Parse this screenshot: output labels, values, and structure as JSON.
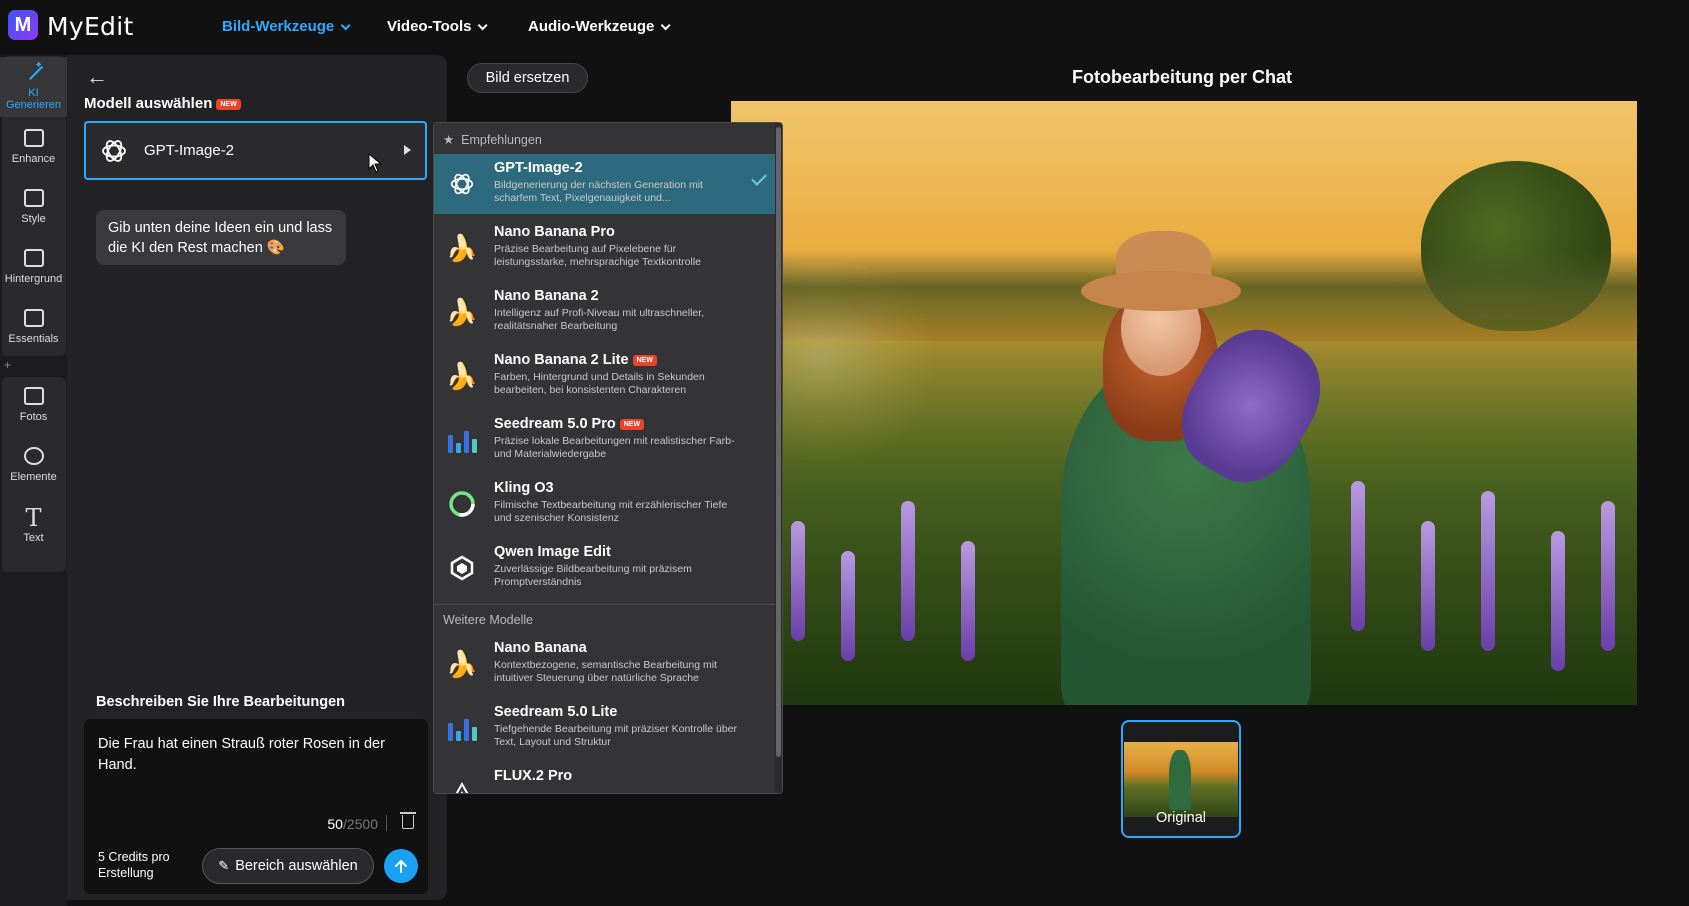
{
  "header": {
    "brand": "MyEdit",
    "logo_letter": "M",
    "nav": [
      {
        "label": "Bild-Werkzeuge",
        "active": true
      },
      {
        "label": "Video-Tools",
        "active": false
      },
      {
        "label": "Audio-Werkzeuge",
        "active": false
      }
    ]
  },
  "rail": {
    "items": [
      {
        "label": "KI Generieren",
        "icon": "magic-wand-icon",
        "active": true
      },
      {
        "label": "Enhance",
        "icon": "enhance-icon"
      },
      {
        "label": "Style",
        "icon": "style-icon"
      },
      {
        "label": "Hintergrund",
        "icon": "background-icon"
      },
      {
        "label": "Essentials",
        "icon": "essentials-icon"
      },
      {
        "label": "Fotos",
        "icon": "photos-icon"
      },
      {
        "label": "Elemente",
        "icon": "elements-icon"
      },
      {
        "label": "Text",
        "icon": "text-icon"
      }
    ],
    "add_symbol": "+"
  },
  "panel": {
    "model_label": "Modell auswählen",
    "new_badge": "NEW",
    "selected_model": "GPT-Image-2",
    "bubble_text": "Gib unten deine Ideen ein und lass die KI den Rest machen 🎨",
    "describe_label": "Beschreiben Sie Ihre Bearbeitungen",
    "prompt_value": "Die Frau hat einen Strauß roter Rosen in der Hand.",
    "char_count": "50",
    "char_max": "/2500",
    "credits": "5 Credits pro Erstellung",
    "area_button": "Bereich auswählen"
  },
  "workspace": {
    "replace_button": "Bild ersetzen",
    "title": "Fotobearbeitung per Chat",
    "thumbnail_label": "Original"
  },
  "dropdown": {
    "section_recommended": "Empfehlungen",
    "section_more": "Weitere Modelle",
    "items": [
      {
        "name": "GPT-Image-2",
        "desc": "Bildgenerierung der nächsten Generation mit scharfem Text, Pixelgenauigkeit und...",
        "icon": "openai-icon",
        "selected": true
      },
      {
        "name": "Nano Banana Pro",
        "desc": "Präzise Bearbeitung auf Pixelebene für leistungsstarke, mehrsprachige Textkontrolle",
        "icon": "banana-icon"
      },
      {
        "name": "Nano Banana 2",
        "desc": "Intelligenz auf Profi-Niveau mit ultraschneller, realitätsnaher Bearbeitung",
        "icon": "banana-icon"
      },
      {
        "name": "Nano Banana 2 Lite",
        "desc": "Farben, Hintergrund und Details in Sekunden bearbeiten, bei konsistenten Charakteren",
        "icon": "banana-icon",
        "badge": "NEW"
      },
      {
        "name": "Seedream 5.0 Pro",
        "desc": "Präzise lokale Bearbeitungen mit realistischer Farb- und Materialwiedergabe",
        "icon": "seedream-bars-icon",
        "badge": "NEW"
      },
      {
        "name": "Kling O3",
        "desc": "Filmische Textbearbeitung mit erzählerischer Tiefe und szenischer Konsistenz",
        "icon": "kling-icon"
      },
      {
        "name": "Qwen Image Edit",
        "desc": "Zuverlässige Bildbearbeitung mit präzisem Promptverständnis",
        "icon": "qwen-icon"
      },
      {
        "name": "Nano Banana",
        "desc": "Kontextbezogene, semantische Bearbeitung mit intuitiver Steuerung über natürliche Sprache",
        "icon": "banana-icon"
      },
      {
        "name": "Seedream 5.0 Lite",
        "desc": "Tiefgehende Bearbeitung mit präziser Kontrolle über Text, Layout und Struktur",
        "icon": "seedream-bars-icon"
      },
      {
        "name": "FLUX.2 Pro",
        "desc": "",
        "icon": "flux-icon"
      }
    ]
  },
  "colors": {
    "accent": "#2fa8ff",
    "selected_row": "#2e6a7e",
    "new_badge": "#e8452c",
    "send_button": "#1aa0f5"
  }
}
